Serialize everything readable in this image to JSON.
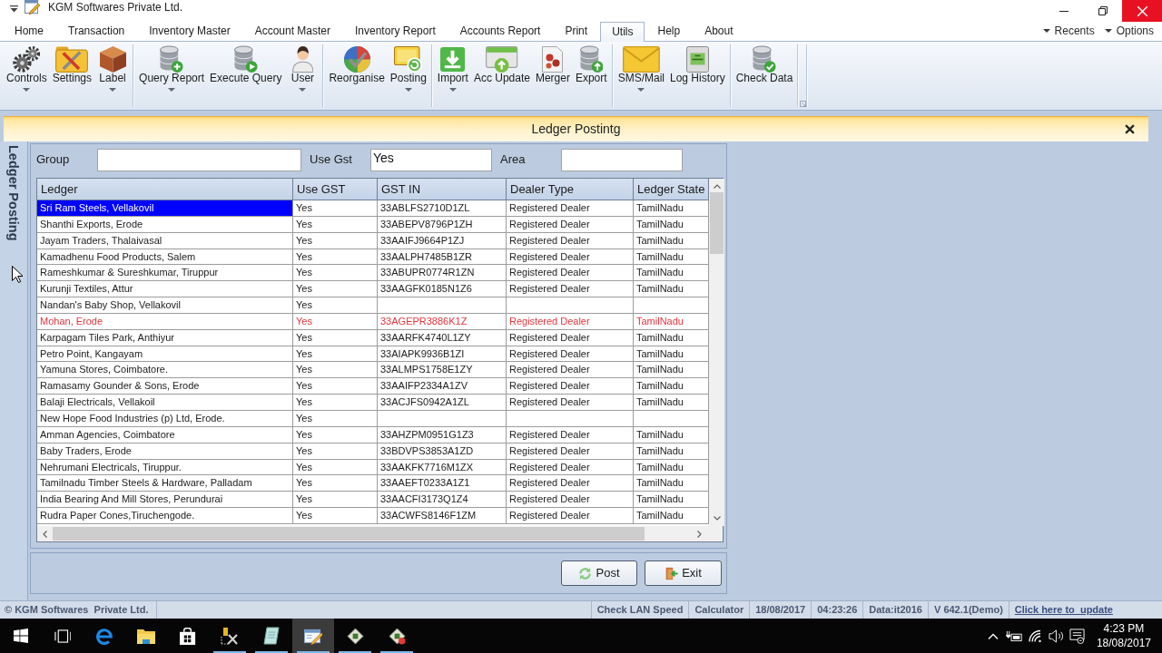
{
  "window": {
    "title": "KGM Softwares Private Ltd."
  },
  "menu": {
    "tabs": [
      {
        "label": "Home",
        "selected": false
      },
      {
        "label": "Transaction",
        "selected": false
      },
      {
        "label": "Inventory Master",
        "selected": false
      },
      {
        "label": "Account Master",
        "selected": false
      },
      {
        "label": "Inventory Report",
        "selected": false
      },
      {
        "label": "Accounts Report",
        "selected": false
      },
      {
        "label": "Print",
        "selected": false
      },
      {
        "label": "Utils",
        "selected": true
      },
      {
        "label": "Help",
        "selected": false
      },
      {
        "label": "About",
        "selected": false
      }
    ],
    "right": [
      "Recents",
      "Options"
    ]
  },
  "ribbon": {
    "groups": [
      {
        "items": [
          {
            "label": "Controls",
            "kind": "gears",
            "dropdown": true
          },
          {
            "label": "Settings",
            "kind": "toolbox",
            "dropdown": false
          },
          {
            "label": "Label",
            "kind": "box",
            "dropdown": true
          }
        ]
      },
      {
        "items": [
          {
            "label": "Query Report",
            "kind": "dbadd",
            "dropdown": true
          },
          {
            "label": "Execute Query",
            "kind": "dbrun",
            "dropdown": false
          },
          {
            "label": "User",
            "kind": "person",
            "dropdown": true
          }
        ]
      },
      {
        "items": [
          {
            "label": "Reorganise",
            "kind": "chart",
            "dropdown": false
          },
          {
            "label": "Posting",
            "kind": "posting",
            "dropdown": true
          }
        ]
      },
      {
        "items": [
          {
            "label": "Import",
            "kind": "download",
            "dropdown": true
          },
          {
            "label": "Acc Update",
            "kind": "cardup",
            "dropdown": false
          },
          {
            "label": "Merger",
            "kind": "merge",
            "dropdown": false
          },
          {
            "label": "Export",
            "kind": "dbup",
            "dropdown": false
          }
        ]
      },
      {
        "items": [
          {
            "label": "SMS/Mail",
            "kind": "mail",
            "dropdown": true
          },
          {
            "label": "Log History",
            "kind": "log",
            "dropdown": false
          }
        ]
      },
      {
        "items": [
          {
            "label": "Check Data",
            "kind": "dbcheck",
            "dropdown": false
          }
        ]
      }
    ]
  },
  "dialog": {
    "title": "Ledger Postintg",
    "side_tab": "Ledger Posting",
    "filters": [
      {
        "label": "Group"
      },
      {
        "label": "Use Gst",
        "value": "Yes"
      },
      {
        "label": "Area"
      }
    ],
    "table": {
      "columns": [
        "Ledger",
        "Use GST",
        "GST IN",
        "Dealer Type",
        "Ledger State"
      ],
      "rows": [
        {
          "ledger": "Sri Ram Steels, Vellakovil",
          "use_gst": "Yes",
          "gst_in": "33ABLFS2710D1ZL",
          "dealer_type": "Registered Dealer",
          "ledger_state": "TamilNadu",
          "selected": true,
          "flagged": false
        },
        {
          "ledger": "Shanthi Exports, Erode",
          "use_gst": "Yes",
          "gst_in": "33ABEPV8796P1ZH",
          "dealer_type": "Registered Dealer",
          "ledger_state": "TamilNadu",
          "selected": false,
          "flagged": false
        },
        {
          "ledger": "Jayam Traders, Thalaivasal",
          "use_gst": "Yes",
          "gst_in": "33AAIFJ9664P1ZJ",
          "dealer_type": "Registered Dealer",
          "ledger_state": "TamilNadu",
          "selected": false,
          "flagged": false
        },
        {
          "ledger": "Kamadhenu Food Products, Salem",
          "use_gst": "Yes",
          "gst_in": "33AALPH7485B1ZR",
          "dealer_type": "Registered Dealer",
          "ledger_state": "TamilNadu",
          "selected": false,
          "flagged": false
        },
        {
          "ledger": "Rameshkumar & Sureshkumar, Tiruppur",
          "use_gst": "Yes",
          "gst_in": "33ABUPR0774R1ZN",
          "dealer_type": "Registered Dealer",
          "ledger_state": "TamilNadu",
          "selected": false,
          "flagged": false
        },
        {
          "ledger": "Kurunji Textiles, Attur",
          "use_gst": "Yes",
          "gst_in": "33AAGFK0185N1Z6",
          "dealer_type": "Registered Dealer",
          "ledger_state": "TamilNadu",
          "selected": false,
          "flagged": false
        },
        {
          "ledger": "Nandan's Baby Shop, Vellakovil",
          "use_gst": "Yes",
          "selected": false,
          "flagged": false
        },
        {
          "ledger": "Mohan, Erode",
          "use_gst": "Yes",
          "gst_in": "33AGEPR3886K1Z",
          "dealer_type": "Registered Dealer",
          "ledger_state": "TamilNadu",
          "selected": false,
          "flagged": true
        },
        {
          "ledger": "Karpagam Tiles Park, Anthiyur",
          "use_gst": "Yes",
          "gst_in": "33AARFK4740L1ZY",
          "dealer_type": "Registered Dealer",
          "ledger_state": "TamilNadu",
          "selected": false,
          "flagged": false
        },
        {
          "ledger": "Petro Point, Kangayam",
          "use_gst": "Yes",
          "gst_in": "33AIAPK9936B1ZI",
          "dealer_type": "Registered Dealer",
          "ledger_state": "TamilNadu",
          "selected": false,
          "flagged": false
        },
        {
          "ledger": "Yamuna Stores, Coimbatore.",
          "use_gst": "Yes",
          "gst_in": "33ALMPS1758E1ZY",
          "dealer_type": "Registered Dealer",
          "ledger_state": "TamilNadu",
          "selected": false,
          "flagged": false
        },
        {
          "ledger": "Ramasamy Gounder & Sons, Erode",
          "use_gst": "Yes",
          "gst_in": "33AAIFP2334A1ZV",
          "dealer_type": "Registered Dealer",
          "ledger_state": "TamilNadu",
          "selected": false,
          "flagged": false
        },
        {
          "ledger": "Balaji Electricals, Vellakoil",
          "use_gst": "Yes",
          "gst_in": "33ACJFS0942A1ZL",
          "dealer_type": "Registered Dealer",
          "ledger_state": "TamilNadu",
          "selected": false,
          "flagged": false
        },
        {
          "ledger": "New Hope Food Industries (p) Ltd, Erode.",
          "use_gst": "Yes",
          "selected": false,
          "flagged": false
        },
        {
          "ledger": "Amman Agencies, Coimbatore",
          "use_gst": "Yes",
          "gst_in": "33AHZPM0951G1Z3",
          "dealer_type": "Registered Dealer",
          "ledger_state": "TamilNadu",
          "selected": false,
          "flagged": false
        },
        {
          "ledger": "Baby Traders, Erode",
          "use_gst": "Yes",
          "gst_in": "33BDVPS3853A1ZD",
          "dealer_type": "Registered Dealer",
          "ledger_state": "TamilNadu",
          "selected": false,
          "flagged": false
        },
        {
          "ledger": "Nehrumani Electricals, Tiruppur.",
          "use_gst": "Yes",
          "gst_in": "33AAKFK7716M1ZX",
          "dealer_type": "Registered Dealer",
          "ledger_state": "TamilNadu",
          "selected": false,
          "flagged": false
        },
        {
          "ledger": "Tamilnadu Timber Steels & Hardware, Palladam",
          "use_gst": "Yes",
          "gst_in": "33AAEFT0233A1Z1",
          "dealer_type": "Registered Dealer",
          "ledger_state": "TamilNadu",
          "selected": false,
          "flagged": false
        },
        {
          "ledger": "India Bearing And Mill Stores, Perundurai",
          "use_gst": "Yes",
          "gst_in": "33AACFI3173Q1Z4",
          "dealer_type": "Registered Dealer",
          "ledger_state": "TamilNadu",
          "selected": false,
          "flagged": false
        },
        {
          "ledger": "Rudra Paper Cones,Tiruchengode.",
          "use_gst": "Yes",
          "gst_in": "33ACWFS8146F1ZM",
          "dealer_type": "Registered Dealer",
          "ledger_state": "TamilNadu",
          "selected": false,
          "flagged": false
        }
      ]
    },
    "buttons": [
      {
        "label": "Post",
        "kind": "post"
      },
      {
        "label": "Exit",
        "kind": "exit"
      }
    ]
  },
  "status_bar": {
    "company": "© KGM Softwares  Private Ltd.",
    "items": [
      {
        "text": "Check LAN Speed",
        "kind": "text"
      },
      {
        "text": "Calculator",
        "kind": "text"
      },
      {
        "text": "18/08/2017",
        "kind": "text"
      },
      {
        "text": "04:23:26",
        "kind": "text"
      },
      {
        "text": "Data:it2016",
        "kind": "text"
      },
      {
        "text": "V 642.1(Demo)",
        "kind": "text"
      },
      {
        "text": "Click here to  update",
        "kind": "link"
      }
    ]
  },
  "taskbar": {
    "items": [
      {
        "kind": "start",
        "running": false,
        "selected": false
      },
      {
        "kind": "taskview",
        "running": false,
        "selected": false
      },
      {
        "kind": "browser",
        "running": false,
        "selected": false
      },
      {
        "kind": "folder",
        "running": false,
        "selected": false
      },
      {
        "kind": "store",
        "running": false,
        "selected": false
      },
      {
        "kind": "tools",
        "running": true,
        "selected": false
      },
      {
        "kind": "notepad",
        "running": true,
        "selected": false
      },
      {
        "kind": "editor",
        "running": true,
        "selected": true
      },
      {
        "kind": "package",
        "running": true,
        "selected": false
      },
      {
        "kind": "packagealert",
        "running": true,
        "selected": false
      }
    ],
    "time": "4:23 PM",
    "date": "18/08/2017"
  }
}
